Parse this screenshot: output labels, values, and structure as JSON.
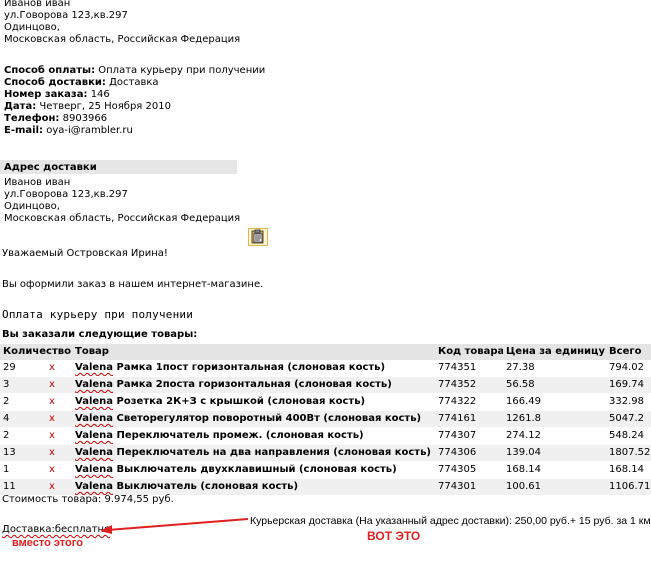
{
  "top_address": {
    "name": "Иванов иван",
    "street": "ул.Говорова 123,кв.297",
    "city": "Одинцово,",
    "region": "Московская область, Российская  Федерация"
  },
  "order_info": {
    "payment_label": "Способ оплаты:",
    "payment_value": "Оплата курьеру при  получении",
    "delivery_label": "Способ доставки:",
    "delivery_value": "Доставка",
    "order_label": "Номер заказа:",
    "order_value": "146",
    "date_label": "Дата:",
    "date_value": "Четверг, 25 Ноября 2010",
    "phone_label": "Телефон:",
    "phone_value": "8903966",
    "email_label": "E-mail:",
    "email_value": "oya-i@rambler.ru"
  },
  "delivery_address": {
    "header": "Адрес доставки",
    "name": "Иванов иван",
    "street": "ул.Говорова 123,кв.297",
    "city": "Одинцово,",
    "region": "Московская область, Российская  Федерация"
  },
  "greeting": "Уважаемый Островская Ирина!",
  "intro": "Вы оформили заказ в нашем интернет-магазине.",
  "payment_mono": "Оплата курьеру при получении",
  "ordered_heading": "Вы заказали следующие товары:",
  "table": {
    "headers": [
      "Количество",
      "Товар",
      "Код товара",
      "Цена за единицу",
      "Всего"
    ],
    "rows": [
      {
        "qty": "29",
        "mark": "x",
        "brand": "Valena",
        "name": "Рамка 1пост горизонтальная (слоновая кость)",
        "code": "774351",
        "price": "27.38",
        "total": "794.02"
      },
      {
        "qty": "3",
        "mark": "x",
        "brand": "Valena",
        "name": "Рамка 2поста горизонтальная (слоновая кость)",
        "code": "774352",
        "price": "56.58",
        "total": "169.74"
      },
      {
        "qty": "2",
        "mark": "x",
        "brand": "Valena",
        "name": "Розетка 2К+З с крышкой (слоновая кость)",
        "code": "774322",
        "price": "166.49",
        "total": "332.98"
      },
      {
        "qty": "4",
        "mark": "x",
        "brand": "Valena",
        "name": "Светорегулятор поворотный 400Вт (слоновая кость)",
        "code": "774161",
        "price": "1261.8",
        "total": "5047.2"
      },
      {
        "qty": "2",
        "mark": "x",
        "brand": "Valena",
        "name": "Переключатель промеж. (слоновая кость)",
        "code": "774307",
        "price": "274.12",
        "total": "548.24"
      },
      {
        "qty": "13",
        "mark": "x",
        "brand": "Valena",
        "name": "Переключатель на два направления (слоновая кость)",
        "code": "774306",
        "price": "139.04",
        "total": "1807.52"
      },
      {
        "qty": "1",
        "mark": "x",
        "brand": "Valena",
        "name": "Выключатель двухклавишный (слоновая кость)",
        "code": "774305",
        "price": "168.14",
        "total": "168.14"
      },
      {
        "qty": "11",
        "mark": "x",
        "brand": "Valena",
        "name": "Выключатель (слоновая кость)",
        "code": "774301",
        "price": "100.61",
        "total": "1106.71"
      }
    ]
  },
  "cost_line": "Стоимость товара: 9.974,55 руб.",
  "delivery_free": "Доставка:бесплатно",
  "delivery_right": "Курьерская доставка (На указанный адрес доставки): 250,00 руб.+ 15 руб. за 1 км.",
  "annotation_instead": "вместо этого",
  "annotation_this": "ВОТ ЭТО",
  "colors": {
    "annotation_red": "#e02020",
    "header_grey": "#e6e6e6"
  }
}
